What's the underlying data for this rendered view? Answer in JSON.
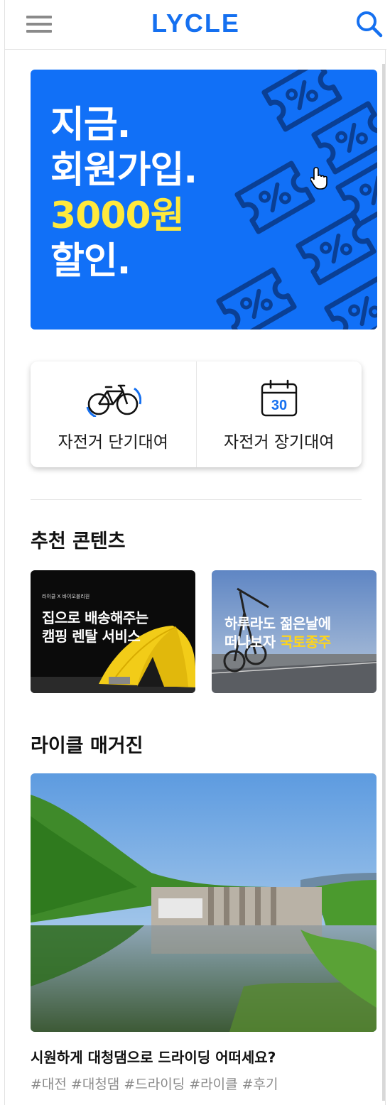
{
  "header": {
    "logo": "LYCLE",
    "menu_icon": "hamburger-menu-icon",
    "search_icon": "search-icon"
  },
  "banner": {
    "lines": [
      "지금.",
      "회원가입.",
      "3000원",
      "할인."
    ],
    "accent_color": "#ffe93c",
    "background": "#1170f7"
  },
  "quick_menu": {
    "items": [
      {
        "label": "자전거 단기대여",
        "icon": "bicycle-icon"
      },
      {
        "label": "자전거 장기대여",
        "icon": "calendar-icon",
        "icon_text": "30"
      }
    ]
  },
  "recommended": {
    "title": "추천 콘텐츠",
    "cards": [
      {
        "small": "라이클 X 바이오블리원",
        "line1": "집으로 배송해주는",
        "line2": "캠핑 렌탈 서비스"
      },
      {
        "line1": "하루라도 젊은날에",
        "line2a": "떠나보자 ",
        "line2b": "국토종주"
      }
    ]
  },
  "magazine": {
    "title": "라이클 매거진",
    "article_title": "시원하게 대청댐으로 드라이딩 어떠세요?",
    "tags": "#대전 #대청댐 #드라이딩 #라이클 #후기"
  },
  "colors": {
    "brand": "#1570f0",
    "banner_blue": "#1170f7",
    "highlight_yellow": "#ffe93c"
  }
}
